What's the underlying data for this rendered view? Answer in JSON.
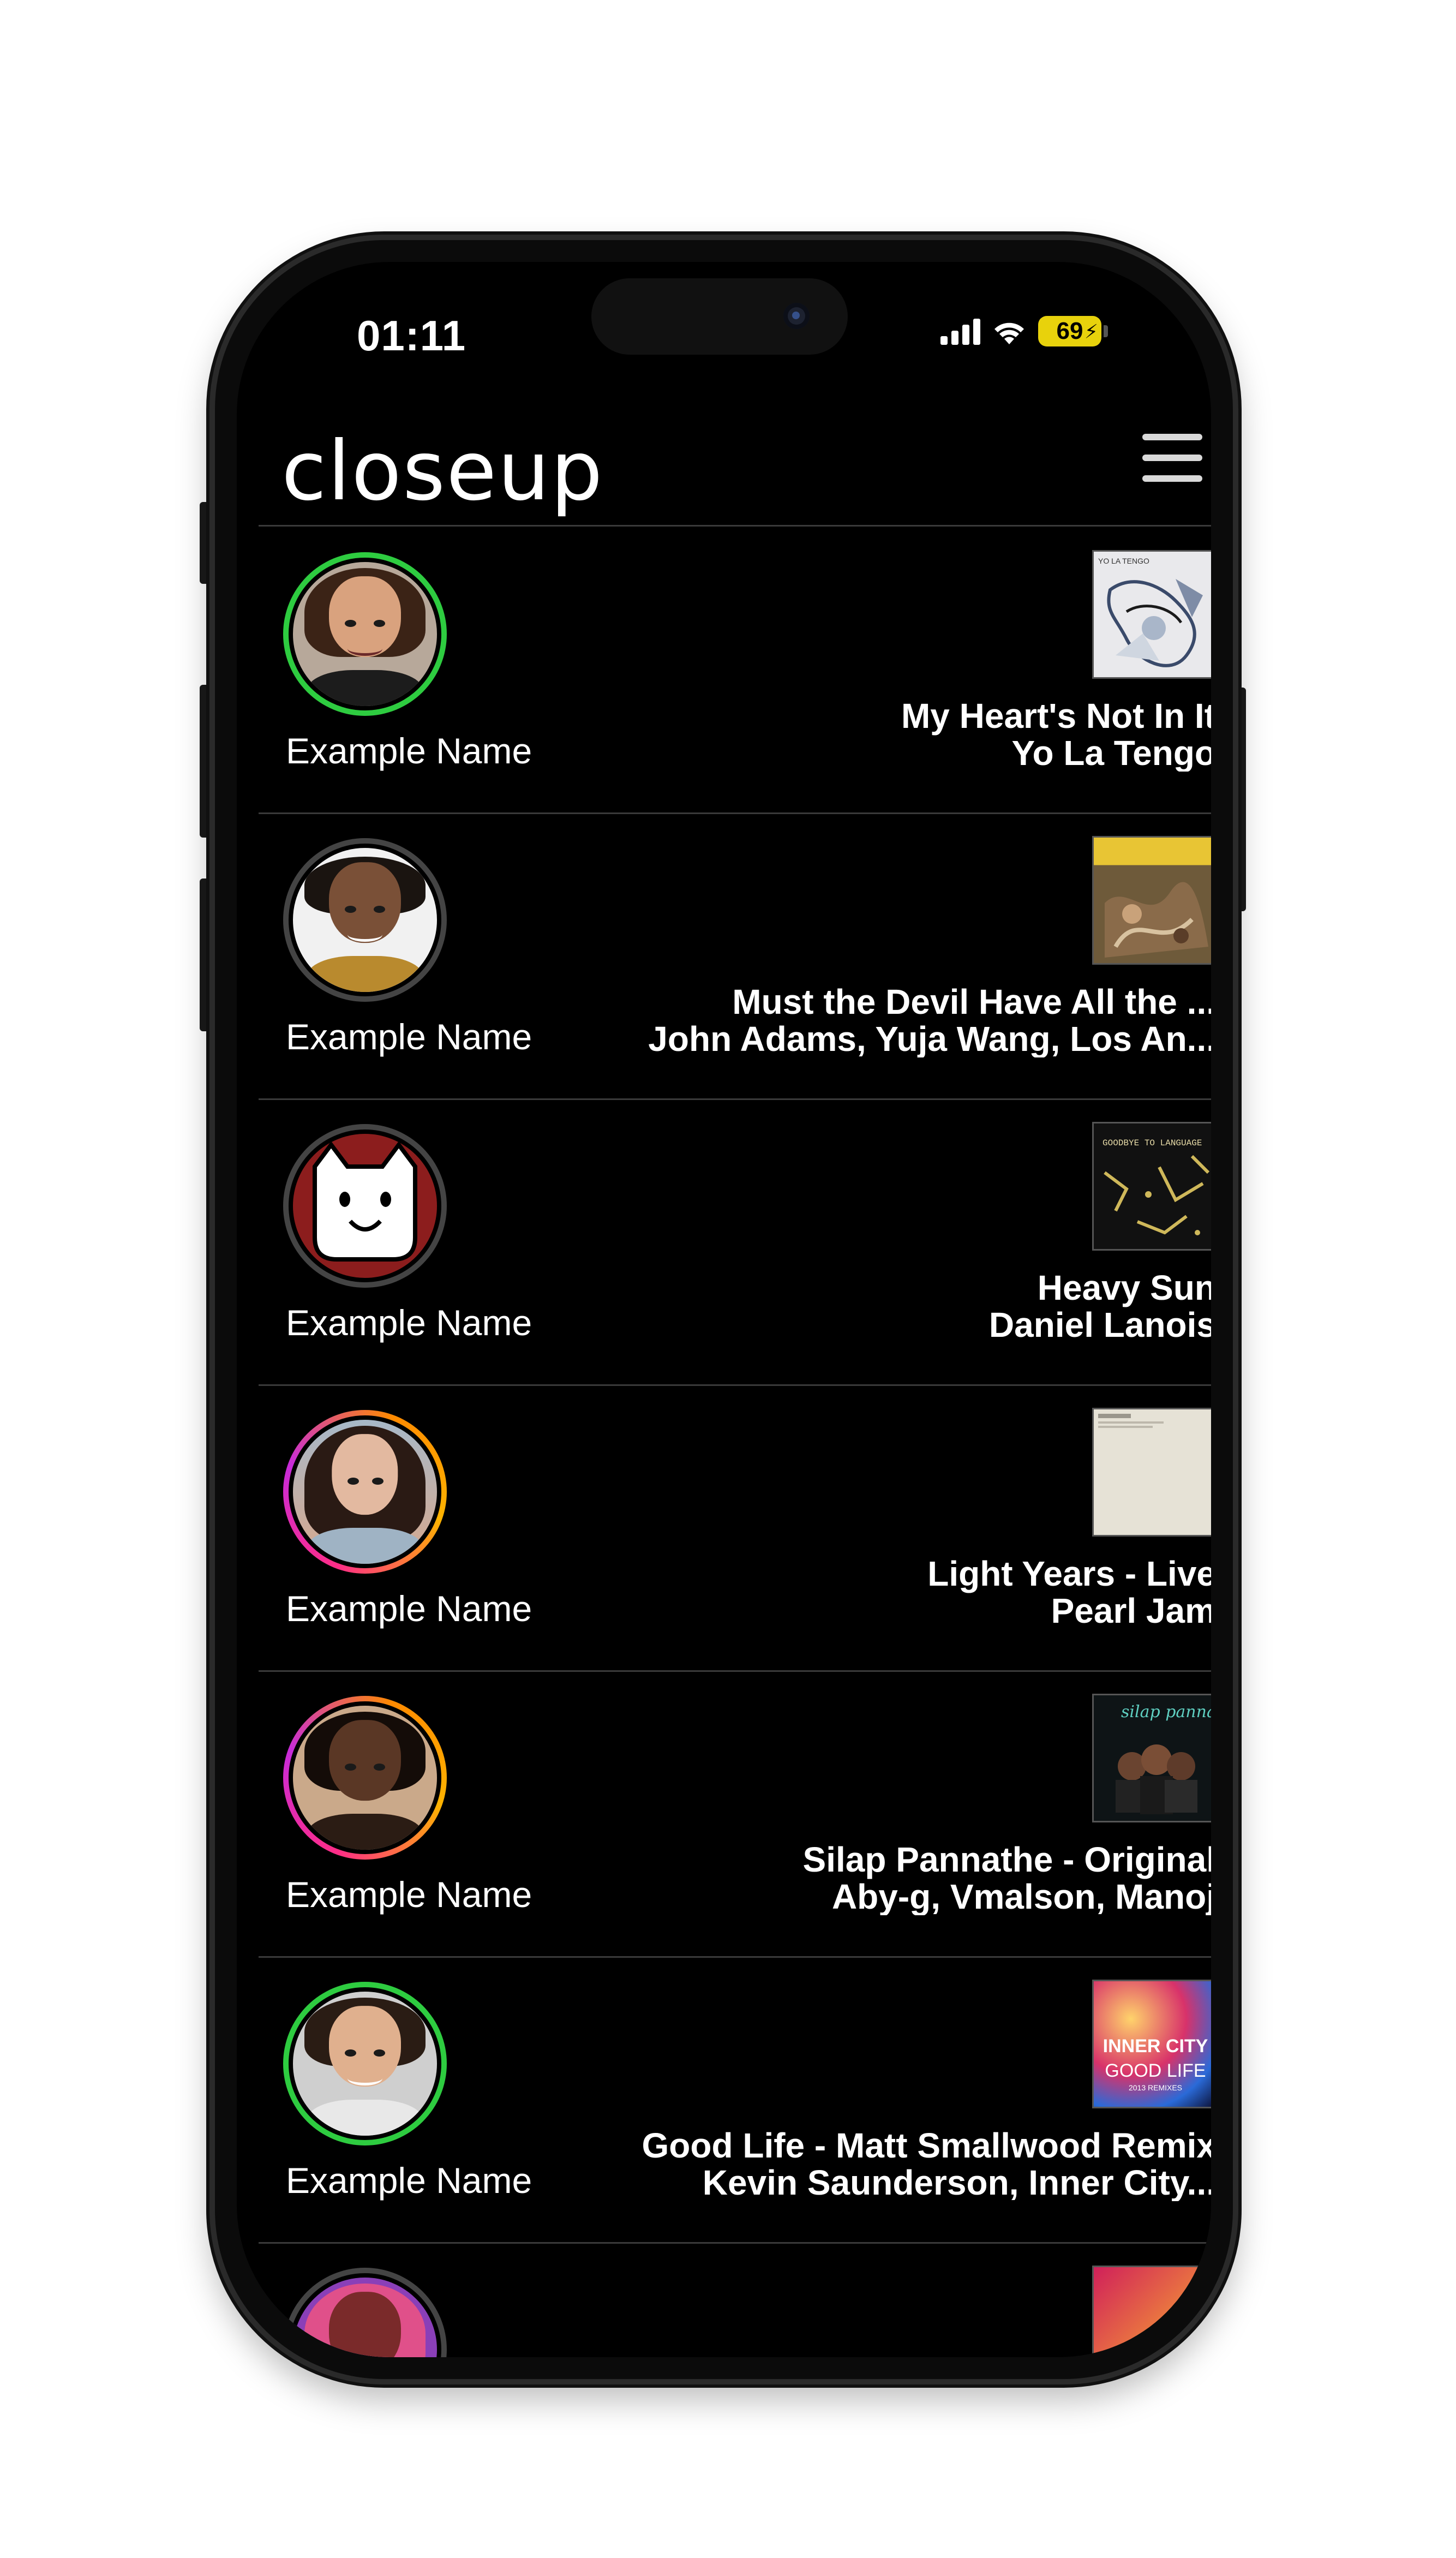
{
  "status_bar": {
    "time": "01:11",
    "battery": "69"
  },
  "app": {
    "title": "closeup"
  },
  "feed": [
    {
      "name": "Example Name",
      "track": "My Heart's Not In It",
      "artist": "Yo La Tengo",
      "ring": "#2ecc40"
    },
    {
      "name": "Example Name",
      "track": "Must the Devil Have All the ...",
      "artist": "John Adams, Yuja Wang, Los An...",
      "ring": "#444444"
    },
    {
      "name": "Example Name",
      "track": "Heavy Sun",
      "artist": "Daniel Lanois",
      "ring": "#444444"
    },
    {
      "name": "Example Name",
      "track": "Light Years - Live",
      "artist": "Pearl Jam",
      "ring": "gradient"
    },
    {
      "name": "Example Name",
      "track": "Silap Pannathe - Original",
      "artist": "Aby-g, Vmalson, Manoj",
      "ring": "gradient"
    },
    {
      "name": "Example Name",
      "track": "Good Life - Matt Smallwood Remix",
      "artist": "Kevin Saunderson, Inner City...",
      "ring": "#2ecc40"
    }
  ],
  "album_art_text": {
    "yo_la_tengo": "YO LA TENGO",
    "lanois": "GOODBYE TO LANGUAGE",
    "inner_city_brand": "INNER CITY",
    "inner_city_title": "GOOD LIFE",
    "inner_city_sub": "2013 REMIXES",
    "silap": "silap pannathe"
  },
  "icons": {
    "menu": "hamburger-icon",
    "signal": "cellular-signal-icon",
    "wifi": "wifi-icon",
    "battery": "battery-icon"
  },
  "colors": {
    "background": "#000000",
    "online_ring": "#2ecc40",
    "battery": "#e8d20c"
  }
}
